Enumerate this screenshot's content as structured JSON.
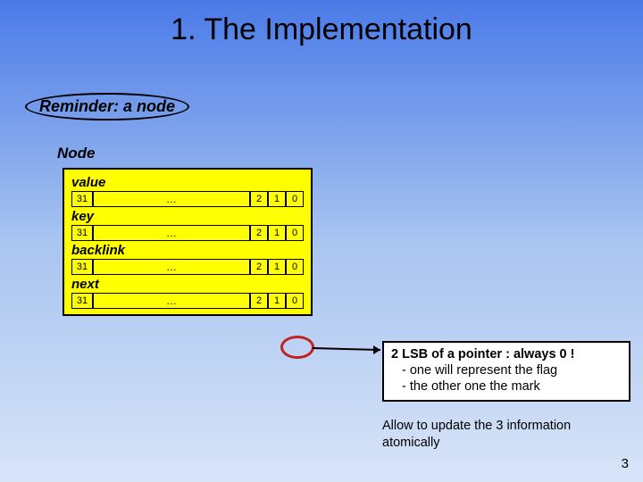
{
  "title": "1. The Implementation",
  "reminder": "Reminder: a node",
  "node_label": "Node",
  "fields": [
    {
      "label": "value",
      "hi": "31",
      "mid": "…",
      "b2": "2",
      "b1": "1",
      "b0": "0"
    },
    {
      "label": "key",
      "hi": "31",
      "mid": "…",
      "b2": "2",
      "b1": "1",
      "b0": "0"
    },
    {
      "label": "backlink",
      "hi": "31",
      "mid": "…",
      "b2": "2",
      "b1": "1",
      "b0": "0"
    },
    {
      "label": "next",
      "hi": "31",
      "mid": "…",
      "b2": "2",
      "b1": "1",
      "b0": "0"
    }
  ],
  "note": {
    "line1": "2 LSB of a pointer : always 0 !",
    "line2": "- one will represent the flag",
    "line3": "- the other one the mark"
  },
  "allow": "Allow to update the 3 information atomically",
  "page_number": "3"
}
